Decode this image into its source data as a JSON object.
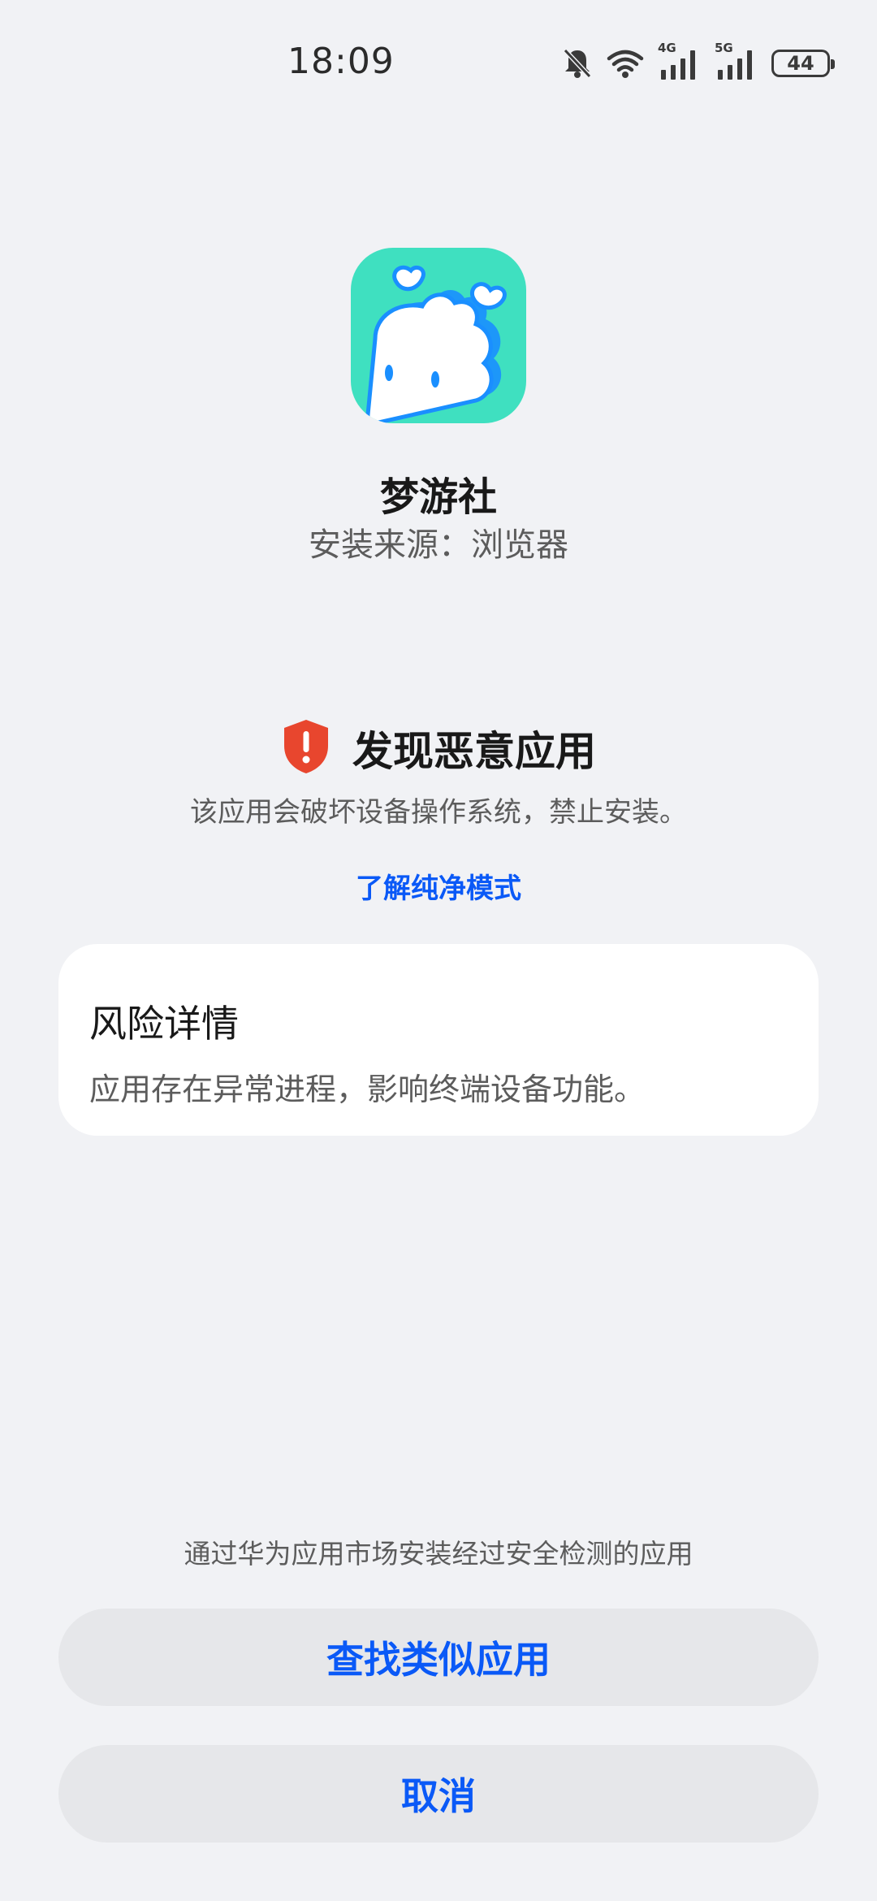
{
  "status_bar": {
    "time": "18:09",
    "icons": [
      "bell-muted-icon",
      "wifi-icon",
      "signal-4g-icon",
      "signal-5g-icon",
      "battery-icon"
    ],
    "network_1": "4G",
    "network_2": "5G",
    "battery_level": "44"
  },
  "app": {
    "name": "梦游社",
    "source": "安装来源：浏览器",
    "icon_colors": {
      "background": "#3fe0c0",
      "character": "#ffffff",
      "outline": "#1a8fff"
    }
  },
  "warning": {
    "icon": "shield-warning-icon",
    "icon_color": "#e8462e",
    "title": "发现恶意应用",
    "description": "该应用会破坏设备操作系统，禁止安装。",
    "learn_more_link": "了解纯净模式"
  },
  "risk_card": {
    "title": "风险详情",
    "body": "应用存在异常进程，影响终端设备功能。"
  },
  "footer": {
    "hint": "通过华为应用市场安装经过安全检测的应用",
    "find_similar_label": "查找类似应用",
    "cancel_label": "取消"
  },
  "colors": {
    "accent": "#0a59f7",
    "page_background": "#f1f2f5",
    "button_background": "#e6e7ea"
  }
}
